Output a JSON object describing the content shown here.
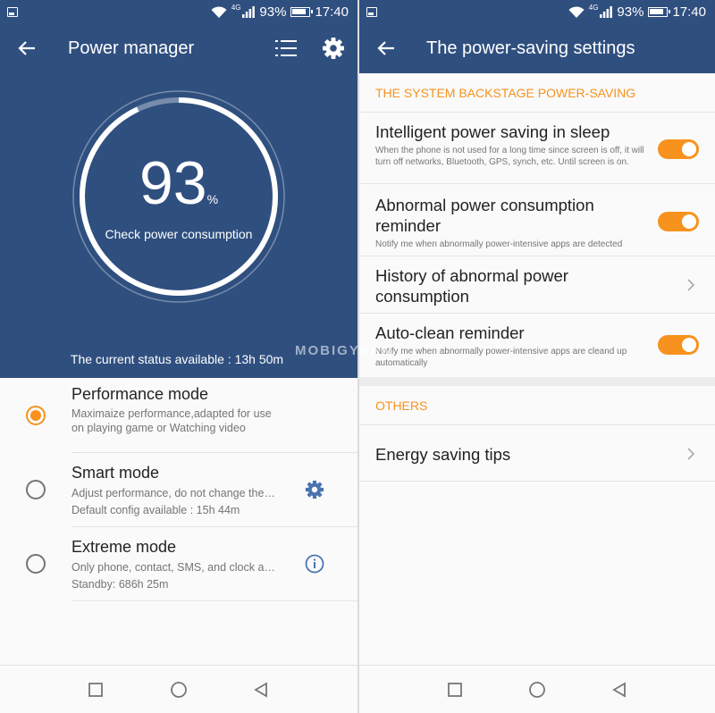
{
  "status_bar": {
    "network": "4G",
    "battery": "93%",
    "time": "17:40"
  },
  "left": {
    "title": "Power manager",
    "battery_value": "93",
    "battery_unit": "%",
    "battery_level": 0.93,
    "check_label": "Check power consumption",
    "status_text": "The current status available : 13h 50m",
    "modes": [
      {
        "title": "Performance mode",
        "desc": "Maximaize performance,adapted for use on playing game or Watching video",
        "sub": "",
        "selected": true,
        "action_icon": ""
      },
      {
        "title": "Smart mode",
        "desc": "Adjust performance, do not change the setting",
        "sub": "Default config available : 15h 44m",
        "selected": false,
        "action_icon": "gear-icon"
      },
      {
        "title": "Extreme mode",
        "desc": "Only phone, contact, SMS, and clock are available",
        "sub": "Standby: 686h 25m",
        "selected": false,
        "action_icon": "info-icon"
      }
    ]
  },
  "right": {
    "title": "The power-saving settings",
    "section1": "THE SYSTEM BACKSTAGE POWER-SAVING",
    "settings": [
      {
        "title": "Intelligent power saving in sleep",
        "desc": "When the phone is not used for a long time since screen is off, it will turn off networks, Bluetooth, GPS, synch, etc. Until screen is on.",
        "control": "toggle",
        "on": true
      },
      {
        "title": "Abnormal power consumption reminder",
        "desc": "Notify me when abnormally power-intensive apps are detected",
        "control": "toggle",
        "on": true
      },
      {
        "title": "History of abnormal power consumption",
        "desc": "",
        "control": "chevron"
      },
      {
        "title": "Auto-clean reminder",
        "desc": "Notify me when abnormally power-intensive apps are cleand up automatically",
        "control": "toggle",
        "on": true
      }
    ],
    "section2": "OTHERS",
    "others": [
      {
        "title": "Energy saving tips",
        "control": "chevron"
      }
    ]
  },
  "watermark": "MOBIGYAAN",
  "colors": {
    "primary": "#2f4f7f",
    "accent": "#f7921e",
    "text": "#222222",
    "secondary_text": "#757575"
  }
}
